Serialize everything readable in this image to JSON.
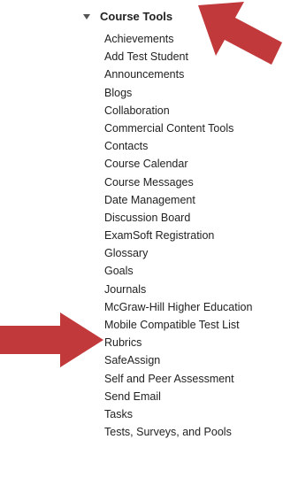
{
  "menu": {
    "section_title": "Course Tools",
    "expanded_icon": "caret-down-icon",
    "items": [
      "Achievements",
      "Add Test Student",
      "Announcements",
      "Blogs",
      "Collaboration",
      "Commercial Content Tools",
      "Contacts",
      "Course Calendar",
      "Course Messages",
      "Date Management",
      "Discussion Board",
      "ExamSoft Registration",
      "Glossary",
      "Goals",
      "Journals",
      "McGraw-Hill Higher Education",
      "Mobile Compatible Test List",
      "Rubrics",
      "SafeAssign",
      "Self and Peer Assessment",
      "Send Email",
      "Tasks",
      "Tests, Surveys, and Pools"
    ]
  },
  "annotations": {
    "arrow_color": "#c1393b",
    "arrows": [
      "annotation-arrow-icon",
      "annotation-arrow-icon"
    ]
  }
}
